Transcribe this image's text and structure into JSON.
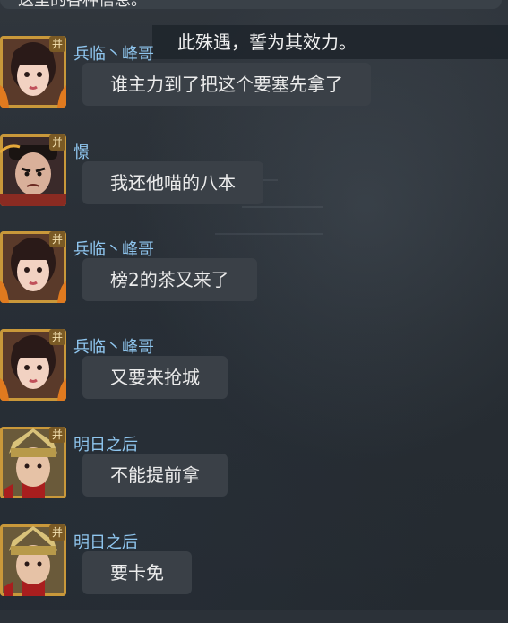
{
  "top_fragment": "这里的各种信息。",
  "system_banner": "此殊遇，誓为其效力。",
  "messages": [
    {
      "sender": "兵临丶峰哥",
      "badge": "并",
      "avatar_icon": "avatar-girl-icon",
      "text": "谁主力到了把这个要塞先拿了"
    },
    {
      "sender": "憬",
      "badge": "并",
      "avatar_icon": "avatar-warrior-icon",
      "text": "我还他喵的八本"
    },
    {
      "sender": "兵临丶峰哥",
      "badge": "并",
      "avatar_icon": "avatar-girl-icon",
      "text": "榜2的茶又来了"
    },
    {
      "sender": "兵临丶峰哥",
      "badge": "并",
      "avatar_icon": "avatar-girl-icon",
      "text": "又要来抢城"
    },
    {
      "sender": "明日之后",
      "badge": "并",
      "avatar_icon": "avatar-knight-icon",
      "text": "不能提前拿"
    },
    {
      "sender": "明日之后",
      "badge": "并",
      "avatar_icon": "avatar-knight-icon",
      "text": "要卡免"
    }
  ],
  "colors": {
    "background": "#2b3138",
    "bubble": "#3a4047",
    "name": "#8fc6ef",
    "avatar_frame": "#c9983a"
  }
}
